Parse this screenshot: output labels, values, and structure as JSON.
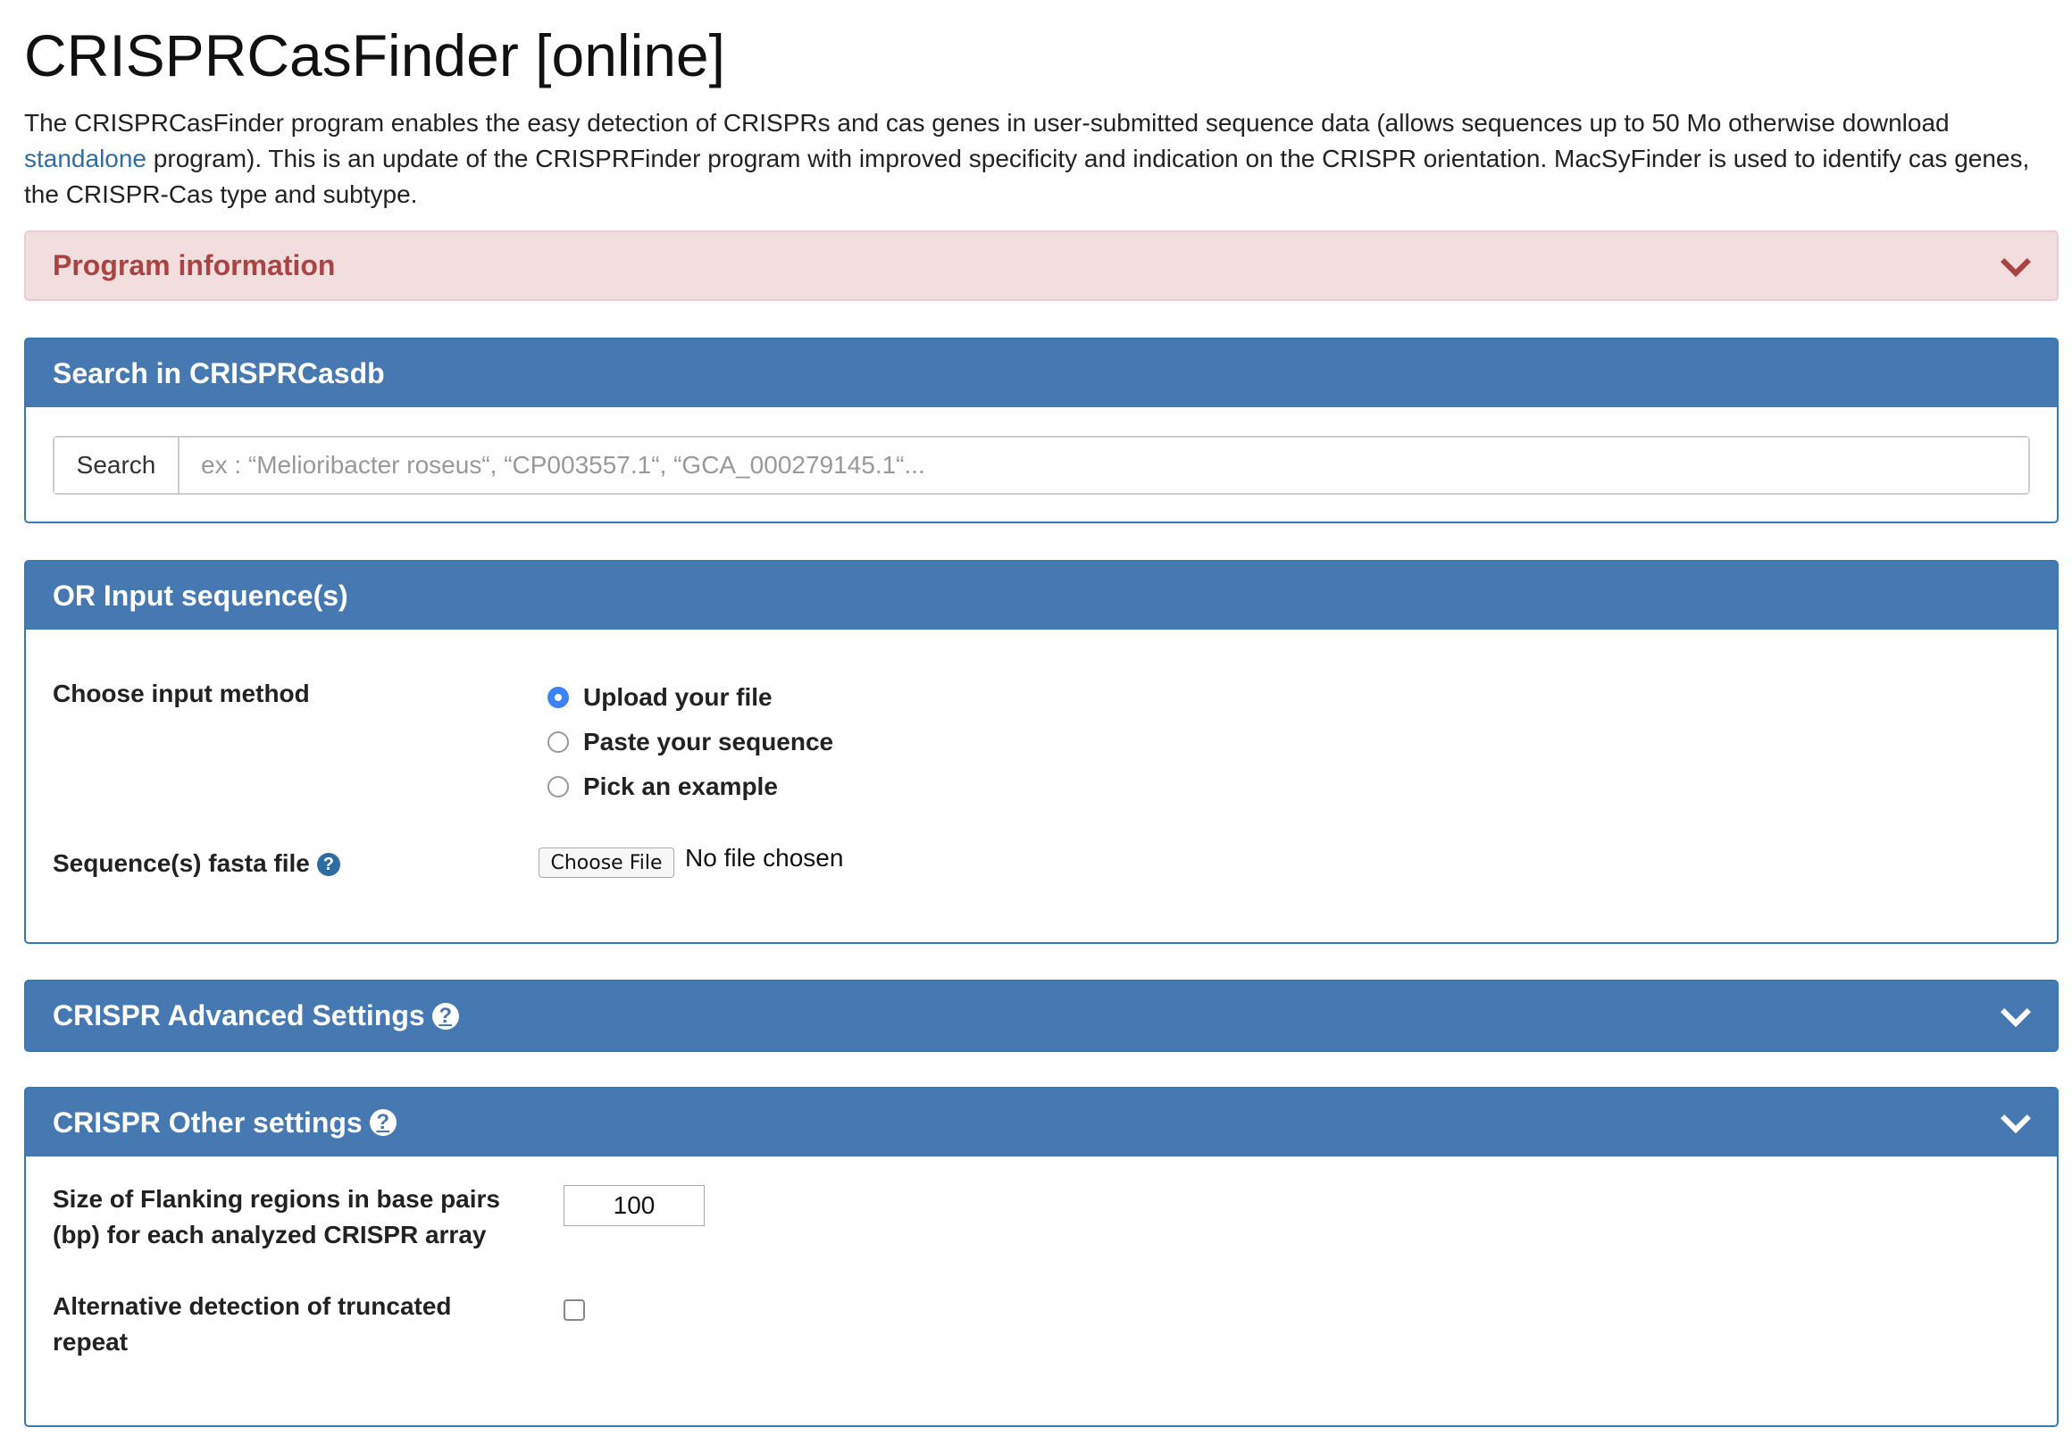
{
  "title": "CRISPRCasFinder [online]",
  "intro": {
    "before_link": "The CRISPRCasFinder program enables the easy detection of CRISPRs and cas genes in user-submitted sequence data (allows sequences up to 50 Mo otherwise download ",
    "link": "standalone",
    "after_link": " program). This is an update of the CRISPRFinder program with improved specificity and indication on the CRISPR orientation. MacSyFinder is used to identify cas genes, the CRISPR-Cas type and subtype."
  },
  "program_info": {
    "title": "Program information",
    "icon": "chevron-down-icon"
  },
  "search_panel": {
    "title": "Search in CRISPRCasdb",
    "button": "Search",
    "placeholder": "ex : “Melioribacter roseus“, “CP003557.1“, “GCA_000279145.1“..."
  },
  "input_panel": {
    "title": "OR Input sequence(s)",
    "method_label": "Choose input method",
    "options": [
      {
        "label": "Upload your file",
        "selected": true
      },
      {
        "label": "Paste your sequence",
        "selected": false
      },
      {
        "label": "Pick an example",
        "selected": false
      }
    ],
    "fasta_label": "Sequence(s) fasta file",
    "help_glyph": "?",
    "file_button": "Choose File",
    "file_status": "No file chosen"
  },
  "advanced_panel": {
    "title": "CRISPR Advanced Settings",
    "help_glyph": "?",
    "icon": "chevron-down-icon"
  },
  "other_panel": {
    "title": "CRISPR Other settings",
    "help_glyph": "?",
    "icon": "chevron-down-icon",
    "flanking_label_1": "Size of Flanking regions in base pairs",
    "flanking_label_2": "(bp) for each analyzed CRISPR array",
    "flanking_value": "100",
    "truncated_label_1": "Alternative detection of truncated",
    "truncated_label_2": "repeat",
    "truncated_checked": false
  },
  "colors": {
    "panel_blue": "#4679b2",
    "info_bg": "#f2dede",
    "info_text": "#a94442",
    "link": "#2e6da4"
  }
}
